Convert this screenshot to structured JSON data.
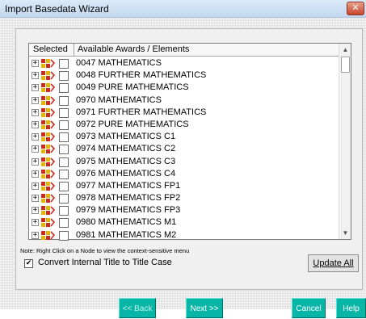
{
  "window": {
    "title": "Import Basedata Wizard",
    "close_glyph": "✕"
  },
  "list": {
    "columns": [
      "Selected",
      "Available Awards / Elements"
    ],
    "items": [
      "0047 MATHEMATICS",
      "0048 FURTHER MATHEMATICS",
      "0049 PURE MATHEMATICS",
      "0970 MATHEMATICS",
      "0971 FURTHER MATHEMATICS",
      "0972 PURE MATHEMATICS",
      "0973 MATHEMATICS C1",
      "0974 MATHEMATICS C2",
      "0975 MATHEMATICS C3",
      "0976 MATHEMATICS C4",
      "0977 MATHEMATICS FP1",
      "0978 MATHEMATICS FP2",
      "0979 MATHEMATICS FP3",
      "0980 MATHEMATICS M1",
      "0981 MATHEMATICS M2"
    ],
    "expander_glyph": "+",
    "node_icon": "award-node-icon",
    "scroll_up_glyph": "▲",
    "scroll_down_glyph": "▼"
  },
  "note": "Note: Right Click on a Node to view the context-sensitive menu",
  "convert": {
    "label": "Convert Internal Title to Title Case",
    "checked": true,
    "check_glyph": "✔"
  },
  "buttons": {
    "update_all": "Update All",
    "back": "<< Back",
    "next": "Next >>",
    "cancel": "Cancel",
    "help": "Help"
  },
  "colors": {
    "nav_button": "#08b6a8",
    "icon_red": "#cc2a1e",
    "icon_yellow": "#e3b400"
  }
}
